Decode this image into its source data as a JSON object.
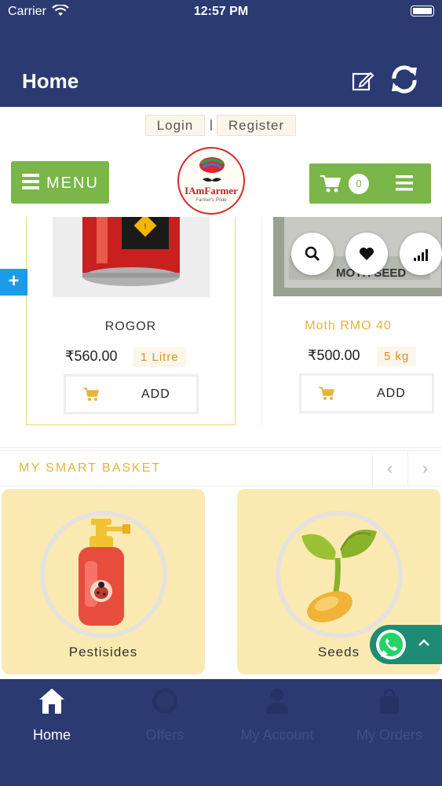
{
  "status_bar": {
    "carrier": "Carrier",
    "time": "12:57 PM"
  },
  "nav": {
    "title": "Home",
    "icons": [
      "edit-icon",
      "refresh-icon"
    ]
  },
  "auth": {
    "login": "Login",
    "separator": "|",
    "register": "Register"
  },
  "header": {
    "menu_label": "MENU",
    "logo_text": "IAmFarmer",
    "logo_tagline": "Farmer's Pride",
    "cart_count": "0"
  },
  "products": [
    {
      "name": "ROGOR",
      "price": "₹560.00",
      "qty": "1 Litre",
      "add_label": "ADD"
    },
    {
      "name": "Moth RMO 40",
      "price": "₹500.00",
      "qty": "5 kg",
      "add_label": "ADD"
    }
  ],
  "basket": {
    "title": "MY SMART BASKET",
    "prev": "‹",
    "next": "›",
    "categories": [
      {
        "label": "Pestisides"
      },
      {
        "label": "Seeds"
      }
    ]
  },
  "tabs": [
    {
      "label": "Home",
      "active": true
    },
    {
      "label": "Offers",
      "active": false
    },
    {
      "label": "My Account",
      "active": false
    },
    {
      "label": "My Orders",
      "active": false
    }
  ],
  "colors": {
    "nav_bg": "#2c3a72",
    "green": "#7ab648",
    "accent_yellow": "#e6b43a",
    "category_bg": "#faeab2",
    "whatsapp": "#1e8c74"
  }
}
